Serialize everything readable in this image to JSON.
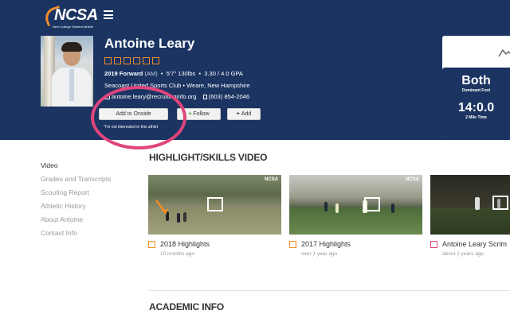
{
  "brand": {
    "logo_text": "NCSA",
    "tagline": "Next College Student Athlete",
    "accent_color": "#f28c28",
    "header_color": "#1b3462"
  },
  "athlete": {
    "name": "Antoine Leary",
    "star_count": 6,
    "class_year": "2019",
    "position": "Forward",
    "position_code": "(AM)",
    "height_weight": "5'7\" 130lbs",
    "gpa": "3.30 / 4.0 GPA",
    "club_location": "Seacoast United Sports Club • Weare, New Hampshire",
    "email": "antoine.leary@recruitinginfo.org",
    "phone": "(603) 854-2046"
  },
  "actions": {
    "add_to_onside": "Add to Onside",
    "follow": "Follow",
    "add": "Add",
    "not_interested": "\"I'm not interested in this athlet"
  },
  "stats": [
    {
      "value": "Both",
      "label": "Dominant Foot"
    },
    {
      "value": "14:0.0",
      "label": "2 Mile Time"
    }
  ],
  "side_nav": [
    "Video",
    "Grades and Transcripts",
    "Scouting Report",
    "Athletic History",
    "About Antoine",
    "Contact Info"
  ],
  "sections": {
    "highlight": "HIGHLIGHT/SKILLS VIDEO",
    "academic": "ACADEMIC INFO"
  },
  "videos": [
    {
      "title": "2018 Highlights",
      "time": "10 months ago",
      "watermark": "NCSA"
    },
    {
      "title": "2017 Highlights",
      "time": "over 1 year ago",
      "watermark": "NCSA"
    },
    {
      "title": "Antoine Leary Scrim",
      "time": "about 2 years ago",
      "watermark": ""
    }
  ]
}
